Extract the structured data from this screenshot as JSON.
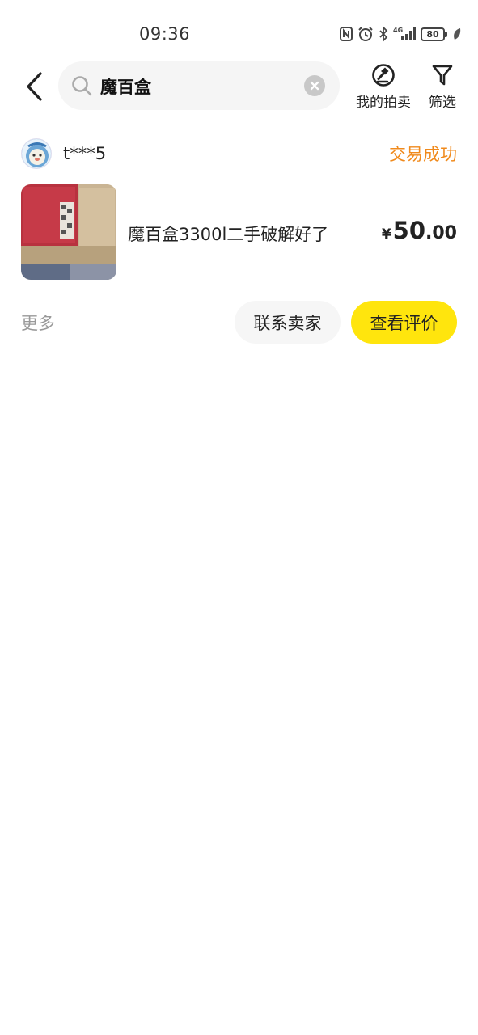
{
  "status_bar": {
    "time": "09:36",
    "battery": "80",
    "icons": [
      "nfc-icon",
      "alarm-icon",
      "bluetooth-icon",
      "signal-4g-icon",
      "battery-icon",
      "leaf-icon"
    ]
  },
  "header": {
    "search_value": "魔百盒",
    "my_auctions_label": "我的拍卖",
    "filter_label": "筛选"
  },
  "order": {
    "seller_name": "t***5",
    "status": "交易成功",
    "product_title": "魔百盒3300l二手破解好了",
    "price_currency": "¥",
    "price_integer": "50",
    "price_decimal": ".00",
    "more_label": "更多",
    "contact_seller_label": "联系卖家",
    "view_review_label": "查看评价"
  },
  "colors": {
    "status_orange": "#f08a1c",
    "accent_yellow": "#ffe50d",
    "search_bg": "#f5f5f5"
  }
}
